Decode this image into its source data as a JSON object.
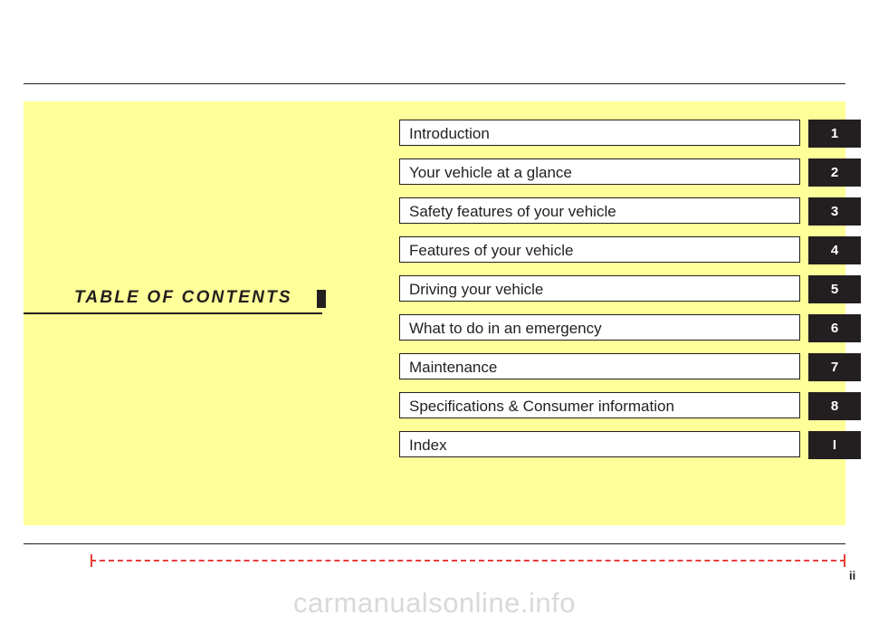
{
  "document": {
    "heading": "TABLE  OF  CONTENTS",
    "page_number": "ii",
    "watermark": "carmanualsonline.info",
    "colors": {
      "panel": "#ffff99",
      "ink": "#231f20",
      "tab_text": "#ffffff",
      "dashed_bar": "#e8403a"
    }
  },
  "contents": [
    {
      "label": "Introduction",
      "tab": "1"
    },
    {
      "label": "Your vehicle at a glance",
      "tab": "2"
    },
    {
      "label": "Safety features of your vehicle",
      "tab": "3"
    },
    {
      "label": "Features of your vehicle",
      "tab": "4"
    },
    {
      "label": "Driving your vehicle",
      "tab": "5"
    },
    {
      "label": "What to do in an emergency",
      "tab": "6"
    },
    {
      "label": "Maintenance",
      "tab": "7"
    },
    {
      "label": "Specifications & Consumer information",
      "tab": "8"
    },
    {
      "label": "Index",
      "tab": "I"
    }
  ]
}
